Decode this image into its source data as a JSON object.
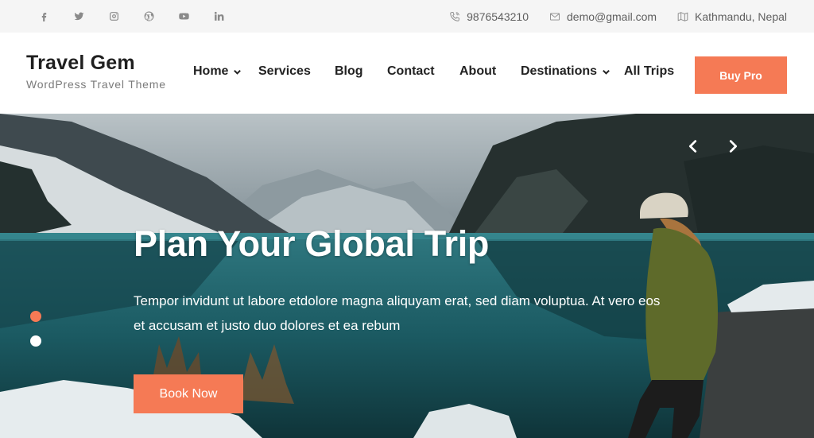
{
  "topbar": {
    "social": [
      "facebook-icon",
      "twitter-icon",
      "instagram-icon",
      "wordpress-icon",
      "youtube-icon",
      "linkedin-icon"
    ],
    "phone": "9876543210",
    "email": "demo@gmail.com",
    "location": "Kathmandu, Nepal"
  },
  "header": {
    "site_title": "Travel Gem",
    "tagline": "WordPress Travel Theme",
    "nav": {
      "home": "Home",
      "services": "Services",
      "blog": "Blog",
      "contact": "Contact",
      "about": "About",
      "destinations": "Destinations",
      "all_trips": "All Trips"
    },
    "buy_button": "Buy Pro"
  },
  "hero": {
    "title": "Plan Your Global Trip",
    "text": "Tempor invidunt ut labore etdolore magna aliquyam erat, sed diam voluptua. At vero eos et accusam et justo duo dolores et ea rebum",
    "button": "Book Now",
    "slide_count": 2,
    "active_slide": 1
  },
  "colors": {
    "accent": "#f57a55",
    "topbar_bg": "#f5f5f5",
    "text_dark": "#222222"
  }
}
